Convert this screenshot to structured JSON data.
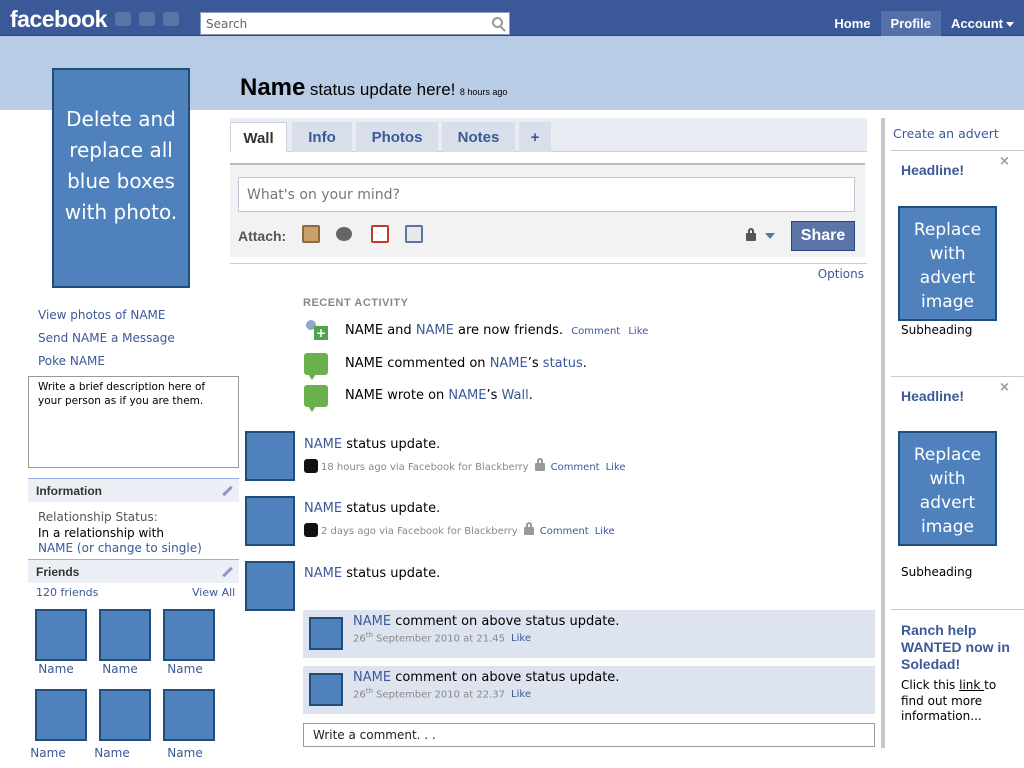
{
  "topbar": {
    "logo": "facebook",
    "search_placeholder": "Search",
    "nav": [
      "Home",
      "Profile",
      "Account"
    ]
  },
  "header": {
    "name": "Name",
    "status": "status update here!",
    "time": "8 hours ago"
  },
  "profile_photo_text": "Delete and replace all blue boxes with photo.",
  "left": {
    "links": [
      "View photos of NAME",
      "Send NAME a Message",
      "Poke NAME"
    ],
    "description": "Write a brief description here of your person as if you are them.",
    "information_title": "Information",
    "relationship_label": "Relationship Status:",
    "relationship_value": "In a relationship with",
    "relationship_link": "NAME (or change to single)",
    "friends_title": "Friends",
    "friends_count": "120 friends",
    "view_all": "View All",
    "friends": [
      "Name",
      "Name",
      "Name",
      "Name",
      "Name",
      "Name"
    ]
  },
  "tabs": [
    "Wall",
    "Info",
    "Photos",
    "Notes",
    "+"
  ],
  "composer": {
    "placeholder": "What's on your mind?",
    "attach_label": "Attach:",
    "share": "Share",
    "options": "Options"
  },
  "recent_activity": {
    "title": "RECENT ACTIVITY",
    "friends_row": {
      "a": "NAME",
      "and": "and",
      "b": "NAME",
      "rest": "are now friends.",
      "comment": "Comment",
      "like": "Like"
    },
    "commented_row": {
      "a": "NAME",
      "mid": "commented on",
      "b": "NAME",
      "poss": "’s",
      "target": "status",
      "end": "."
    },
    "wrote_row": {
      "a": "NAME",
      "mid": "wrote on",
      "b": "NAME",
      "poss": "’s",
      "target": "Wall",
      "end": "."
    }
  },
  "statuses": [
    {
      "name": "NAME",
      "text": "status update.",
      "meta": "18 hours ago via Facebook for Blackberry",
      "comment": "Comment",
      "like": "Like"
    },
    {
      "name": "NAME",
      "text": "status update.",
      "meta": "2 days ago via Facebook for Blackberry",
      "comment": "Comment",
      "like": "Like"
    },
    {
      "name": "NAME",
      "text": "status update."
    }
  ],
  "comments": [
    {
      "name": "NAME",
      "text": "comment on above status update.",
      "day": "26",
      "sup": "th",
      "rest": " September 2010 at 21.45",
      "like": "Like"
    },
    {
      "name": "NAME",
      "text": "comment on above status update.",
      "day": "26",
      "sup": "th",
      "rest": " September 2010 at 22.37",
      "like": "Like"
    }
  ],
  "write_comment_placeholder": "Write a comment. . .",
  "right": {
    "create_advert": "Create an advert",
    "ads": [
      {
        "headline": "Headline!",
        "close": "×",
        "image_text": "Replace with advert image",
        "subheading": "Subheading"
      },
      {
        "headline": "Headline!",
        "close": "×",
        "image_text": "Replace with advert image",
        "subheading": "Subheading"
      }
    ],
    "ranch_headline": "Ranch help WANTED now in Soledad!",
    "ranch_pre": "Click this ",
    "ranch_link": "link ",
    "ranch_post": "to find out more information..."
  },
  "colors": {
    "facebook_blue": "#3b5998",
    "placeholder_blue": "#4f81bd",
    "header_band": "#b8cce6",
    "comment_bg": "#dde4ef"
  }
}
